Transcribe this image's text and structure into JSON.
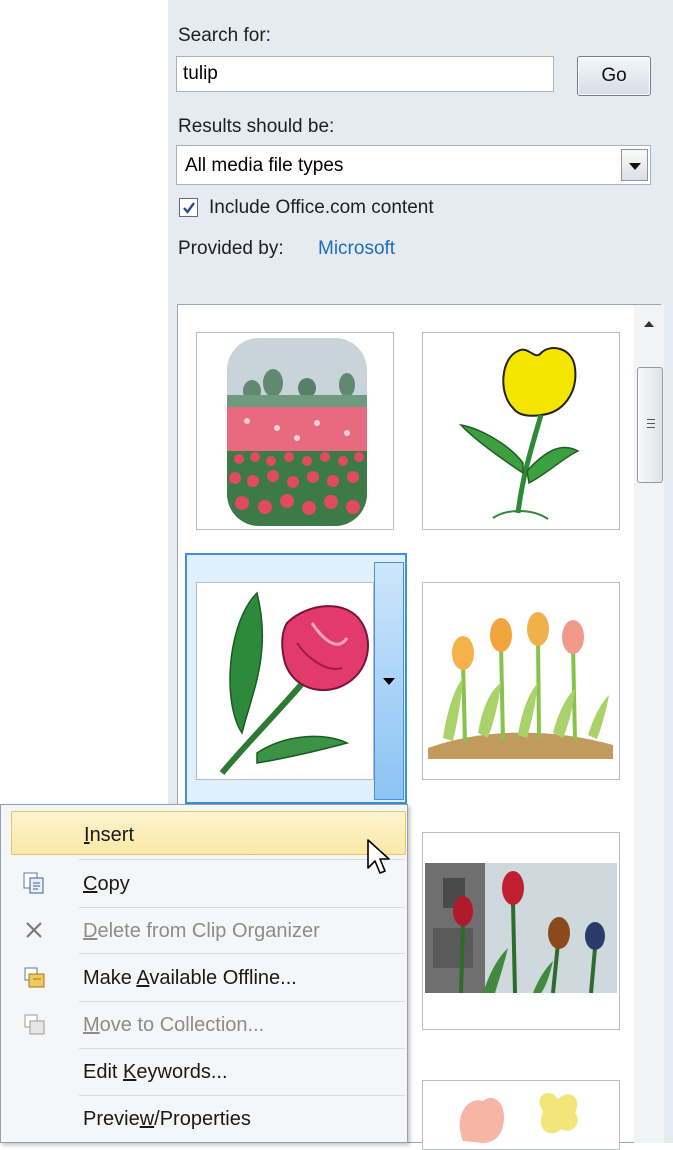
{
  "search": {
    "label": "Search for:",
    "value": "tulip",
    "go_label": "Go"
  },
  "results_type": {
    "label": "Results should be:",
    "selected": "All media file types"
  },
  "include_office": {
    "label": "Include Office.com content",
    "checked": true
  },
  "provider": {
    "label": "Provided by:",
    "link": "Microsoft"
  },
  "results": {
    "items": [
      {
        "name": "tulip-field-clipart"
      },
      {
        "name": "yellow-tulip-sketch-clipart"
      },
      {
        "name": "red-tulip-clipart"
      },
      {
        "name": "tulip-row-clipart"
      },
      {
        "name": "tulip-photo"
      },
      {
        "name": "pink-tulip-butterfly-clipart"
      }
    ]
  },
  "context_menu": {
    "items": [
      {
        "label": "Insert",
        "accel": "I",
        "icon": "none",
        "enabled": true,
        "highlighted": true
      },
      {
        "label": "Copy",
        "accel": "C",
        "icon": "copy-icon",
        "enabled": true
      },
      {
        "label": "Delete from Clip Organizer",
        "accel": "D",
        "icon": "delete-x-icon",
        "enabled": false
      },
      {
        "label": "Make Available Offline...",
        "accel": "A",
        "icon": "make-offline-icon",
        "enabled": true
      },
      {
        "label": "Move to Collection...",
        "accel": "M",
        "icon": "move-collection-icon",
        "enabled": false
      },
      {
        "label": "Edit Keywords...",
        "accel": "K",
        "icon": "none",
        "enabled": true
      },
      {
        "label": "Preview/Properties",
        "accel": "w",
        "icon": "none",
        "enabled": true
      }
    ]
  },
  "colors": {
    "pane_bg": "#e6ebf1",
    "link": "#1e6cc1",
    "selection_border": "#3d8fe0",
    "menu_highlight": "#fbe8a6"
  }
}
